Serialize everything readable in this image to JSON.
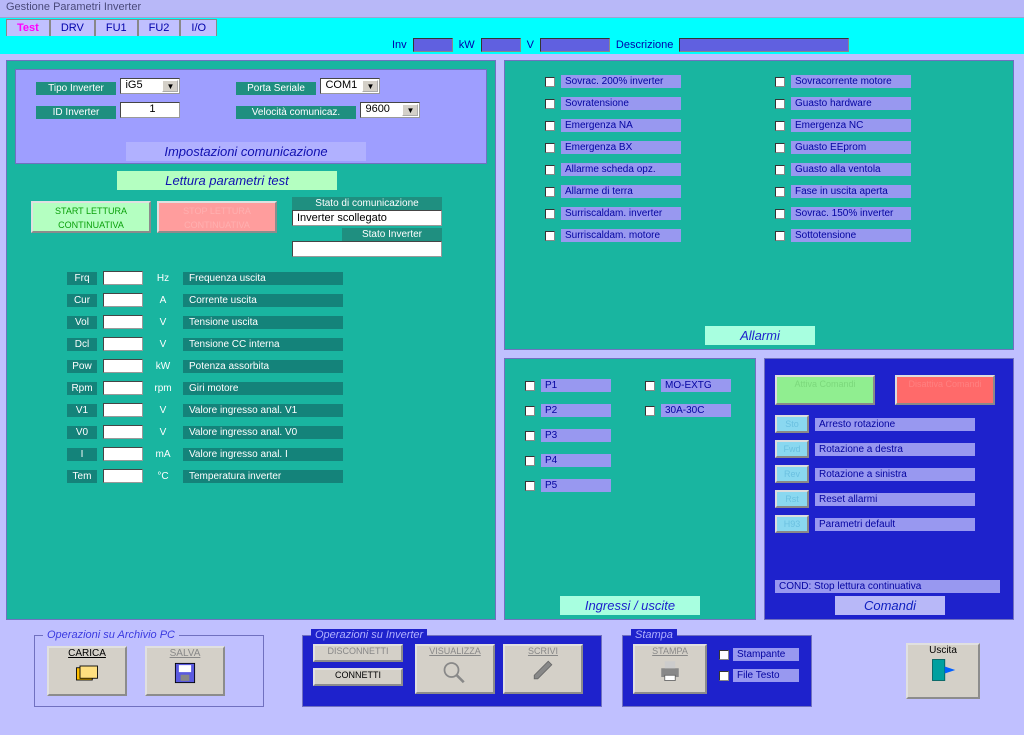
{
  "window": {
    "title": "Gestione Parametri Inverter"
  },
  "tabs": {
    "active": "Test",
    "others": [
      "DRV",
      "FU1",
      "FU2",
      "I/O"
    ]
  },
  "status": {
    "inv": "Inv",
    "kw": "kW",
    "v": "V",
    "desc": "Descrizione"
  },
  "toolbars": {
    "archive": {
      "title": "Operazioni su Archivio PC",
      "carica": "CARICA",
      "salva": "SALVA"
    },
    "inverter": {
      "title": "Operazioni su Inverter",
      "disconnetti": "DISCONNETTI",
      "connetti": "CONNETTI",
      "visualizza": "VISUALIZZA",
      "scrivi": "SCRIVI"
    },
    "stampa": {
      "title": "Stampa",
      "btn": "STAMPA",
      "stampante": "Stampante",
      "filetesto": "File Testo"
    },
    "uscita": "Uscita"
  },
  "comm": {
    "title": "Impostazioni comunicazione",
    "tipo_lbl": "Tipo Inverter",
    "tipo_val": "iG5",
    "porta_lbl": "Porta Seriale",
    "porta_val": "COM1",
    "id_lbl": "ID Inverter",
    "id_val": "1",
    "vel_lbl": "Velocità comunicaz.",
    "vel_val": "9600"
  },
  "lettura": {
    "title": "Lettura parametri test",
    "start": "START LETTURA CONTINUATIVA",
    "stop": "STOP LETTURA CONTINUATIVA",
    "stato_com_lbl": "Stato di comunicazione",
    "stato_com": "Inverter scollegato",
    "stato_inv_lbl": "Stato Inverter",
    "stato_inv": "",
    "rows": [
      {
        "k": "Frq",
        "u": "Hz",
        "l": "Frequenza uscita"
      },
      {
        "k": "Cur",
        "u": "A",
        "l": "Corrente uscita"
      },
      {
        "k": "Vol",
        "u": "V",
        "l": "Tensione uscita"
      },
      {
        "k": "Dcl",
        "u": "V",
        "l": "Tensione CC interna"
      },
      {
        "k": "Pow",
        "u": "kW",
        "l": "Potenza assorbita"
      },
      {
        "k": "Rpm",
        "u": "rpm",
        "l": "Giri motore"
      },
      {
        "k": "V1",
        "u": "V",
        "l": "Valore ingresso anal. V1"
      },
      {
        "k": "V0",
        "u": "V",
        "l": "Valore ingresso anal. V0"
      },
      {
        "k": "I",
        "u": "mA",
        "l": "Valore ingresso anal. I"
      },
      {
        "k": "Tem",
        "u": "°C",
        "l": "Temperatura inverter"
      }
    ]
  },
  "allarmi": {
    "title": "Allarmi",
    "col1": [
      "Sovrac. 200% inverter",
      "Sovratensione",
      "Emergenza NA",
      "Emergenza BX",
      "Allarme scheda opz.",
      "Allarme di terra",
      "Surriscaldam. inverter",
      "Surriscaldam. motore"
    ],
    "col2": [
      "Sovracorrente motore",
      "Guasto hardware",
      "Emergenza NC",
      "Guasto EEprom",
      "Guasto alla ventola",
      "Fase in uscita aperta",
      "Sovrac. 150% inverter",
      "Sottotensione"
    ]
  },
  "io": {
    "title": "Ingressi / uscite",
    "left": [
      "P1",
      "P2",
      "P3",
      "P4",
      "P5"
    ],
    "right": [
      "MO-EXTG",
      "30A-30C"
    ]
  },
  "comandi": {
    "title": "Comandi",
    "attiva": "Attiva Comandi",
    "disattiva": "Disattiva Comandi",
    "btns": [
      {
        "k": "Sto",
        "l": "Arresto rotazione"
      },
      {
        "k": "Fwd",
        "l": "Rotazione a destra"
      },
      {
        "k": "Rev",
        "l": "Rotazione a sinistra"
      },
      {
        "k": "Rst",
        "l": "Reset allarmi"
      },
      {
        "k": "H93",
        "l": "Parametri default"
      }
    ],
    "cond": "COND: Stop lettura continuativa"
  }
}
